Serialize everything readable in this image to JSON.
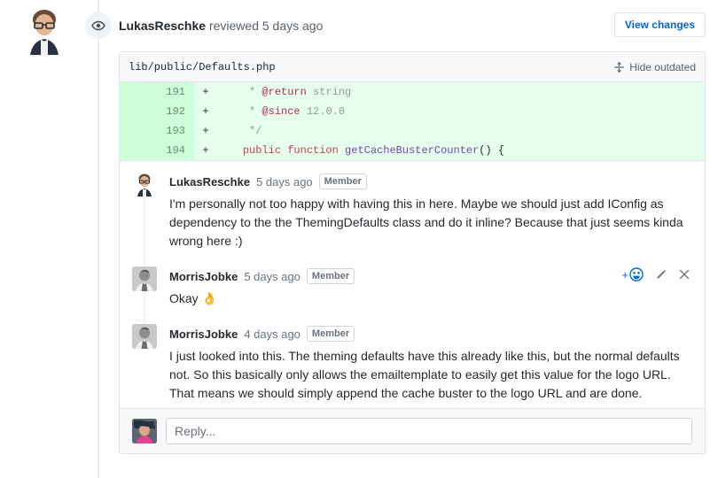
{
  "review": {
    "author": "LukasReschke",
    "action_text": "reviewed",
    "timestamp": "5 days ago",
    "view_changes_label": "View changes",
    "eye_icon": "eye-icon"
  },
  "file": {
    "path": "lib/public/Defaults.php",
    "hide_outdated_label": "Hide outdated",
    "fold_icon": "fold-icon"
  },
  "diff": {
    "lines": [
      {
        "number": "191",
        "sign": "+",
        "segments": [
          {
            "text": "     * ",
            "cls": "c-com"
          },
          {
            "text": "@return",
            "cls": "c-tag"
          },
          {
            "text": " string",
            "cls": "c-com"
          }
        ]
      },
      {
        "number": "192",
        "sign": "+",
        "segments": [
          {
            "text": "     * ",
            "cls": "c-com"
          },
          {
            "text": "@since",
            "cls": "c-tag"
          },
          {
            "text": " 12.0.0",
            "cls": "c-com"
          }
        ]
      },
      {
        "number": "193",
        "sign": "+",
        "segments": [
          {
            "text": "     */",
            "cls": "c-com"
          }
        ]
      },
      {
        "number": "194",
        "sign": "+",
        "segments": [
          {
            "text": "    ",
            "cls": ""
          },
          {
            "text": "public function",
            "cls": "c-kw"
          },
          {
            "text": " ",
            "cls": ""
          },
          {
            "text": "getCacheBusterCounter",
            "cls": "c-fn"
          },
          {
            "text": "() {",
            "cls": ""
          }
        ]
      }
    ]
  },
  "comments": [
    {
      "author": "LukasReschke",
      "timestamp": "5 days ago",
      "badge": "Member",
      "body": "I'm personally not too happy with having this in here. Maybe we should just add IConfig as dependency to the the ThemingDefaults class and do it inline? Because that just seems kinda wrong here :)",
      "has_actions": false
    },
    {
      "author": "MorrisJobke",
      "timestamp": "5 days ago",
      "badge": "Member",
      "body": "Okay 👌",
      "has_actions": true,
      "actions": {
        "add_reaction": "+",
        "add_reaction_icon": "smiley-face-icon",
        "edit_icon": "pencil-icon",
        "close_icon": "close-x-icon"
      }
    },
    {
      "author": "MorrisJobke",
      "timestamp": "4 days ago",
      "badge": "Member",
      "body": "I just looked into this. The theming defaults have this already like this, but the normal defaults not. So this basically only allows the emailtemplate to easily get this value for the logo URL. That means we should simply append the cache buster to the logo URL and are done.",
      "has_actions": false
    }
  ],
  "reply": {
    "placeholder": "Reply...",
    "value": ""
  },
  "colors": {
    "accent": "#0366d6",
    "diff_add_bg": "#e6ffed",
    "diff_add_gutter": "#cdffd8",
    "border": "#e1e4e8",
    "muted_text": "#6a737d"
  }
}
